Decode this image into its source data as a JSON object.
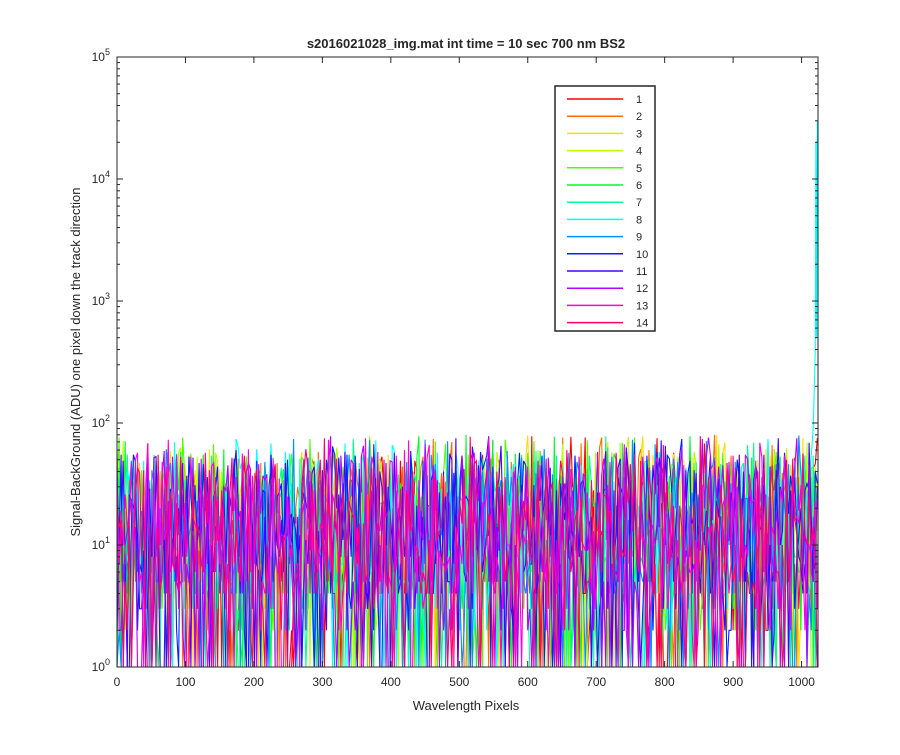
{
  "chart_data": {
    "type": "line",
    "title": "s2016021028_img.mat int time = 10 sec  700 nm BS2",
    "xlabel": "Wavelength Pixels",
    "ylabel": "Signal-BackGround (ADU) one pixel down the track direction",
    "xlim": [
      0,
      1024
    ],
    "ylim": [
      1,
      100000
    ],
    "yscale": "log",
    "x_ticks": [
      "0",
      "100",
      "200",
      "300",
      "400",
      "500",
      "600",
      "700",
      "800",
      "900",
      "1000"
    ],
    "y_ticks": [
      {
        "base": "10",
        "exp": "0"
      },
      {
        "base": "10",
        "exp": "1"
      },
      {
        "base": "10",
        "exp": "2"
      },
      {
        "base": "10",
        "exp": "3"
      },
      {
        "base": "10",
        "exp": "4"
      },
      {
        "base": "10",
        "exp": "5"
      }
    ],
    "grid": false,
    "legend_position": "top-right",
    "noise_floor_range": [
      1,
      80
    ],
    "series": [
      {
        "name": "1",
        "color": "#ff0000"
      },
      {
        "name": "2",
        "color": "#ff6d00"
      },
      {
        "name": "3",
        "color": "#ffdb00"
      },
      {
        "name": "4",
        "color": "#b6ff00"
      },
      {
        "name": "5",
        "color": "#49ff00"
      },
      {
        "name": "6",
        "color": "#00ff24"
      },
      {
        "name": "7",
        "color": "#00ff92"
      },
      {
        "name": "8",
        "color": "#00ffff",
        "peak_x": 1023,
        "peak_value": 30000
      },
      {
        "name": "9",
        "color": "#0092ff"
      },
      {
        "name": "10",
        "color": "#0024ff"
      },
      {
        "name": "11",
        "color": "#4900ff"
      },
      {
        "name": "12",
        "color": "#b600ff"
      },
      {
        "name": "13",
        "color": "#ff00db"
      },
      {
        "name": "14",
        "color": "#ff006d"
      }
    ]
  }
}
